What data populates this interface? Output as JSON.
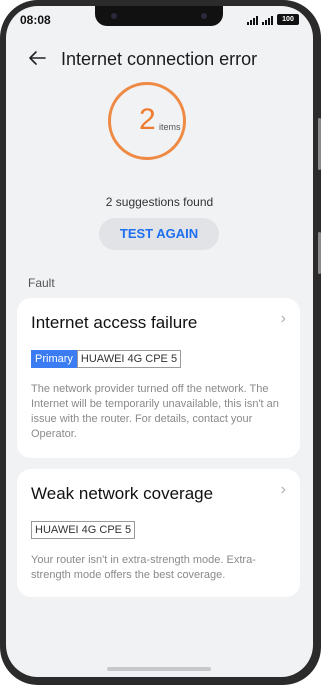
{
  "status_bar": {
    "time": "08:08",
    "signal_1": "signal-icon",
    "signal_2": "signal-icon",
    "battery": "100"
  },
  "header": {
    "back_icon": "back-arrow-icon",
    "title": "Internet connection error"
  },
  "summary": {
    "count": "2",
    "count_unit": "items",
    "ring_color": "#ef8a44",
    "suggestions_text": "2 suggestions found",
    "test_button_label": "TEST AGAIN"
  },
  "section_label": "Fault",
  "faults": [
    {
      "title": "Internet access failure",
      "chevron_icon": "chevron-right-icon",
      "tags": [
        "Primary",
        "HUAWEI 4G CPE 5"
      ],
      "description": "The network provider turned off the network. The Internet will be temporarily unavailable, this isn't an issue with the router. For details, contact your Operator."
    },
    {
      "title": "Weak network coverage",
      "chevron_icon": "chevron-right-icon",
      "tags": [
        "HUAWEI 4G CPE 5"
      ],
      "description": "Your router isn't in extra-strength mode. Extra-strength mode offers the best coverage."
    }
  ],
  "colors": {
    "accent_blue": "#1d6ff0",
    "primary_tag": "#3b7cf2",
    "ring_orange": "#ef8a44"
  }
}
